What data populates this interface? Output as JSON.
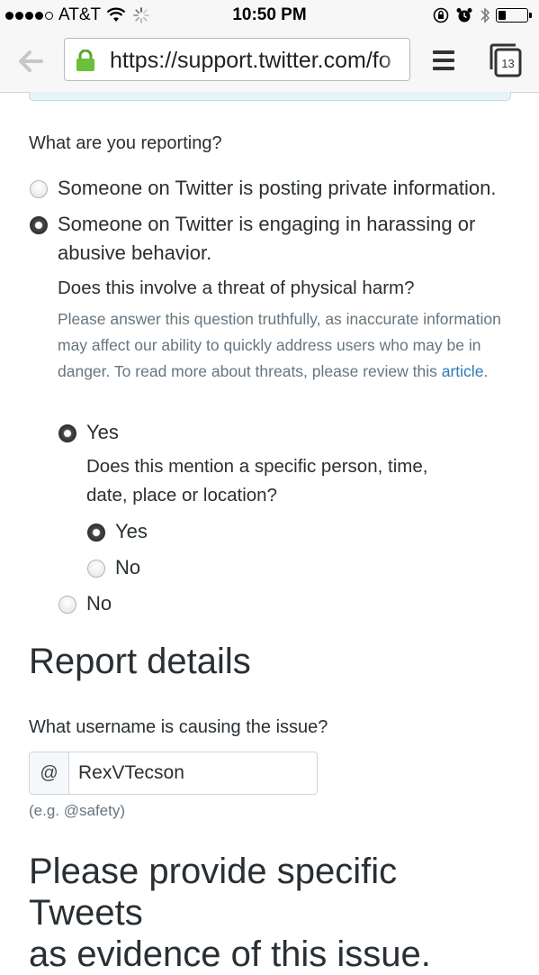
{
  "status_bar": {
    "carrier": "AT&T",
    "time": "10:50 PM",
    "battery_level": 0.25
  },
  "browser": {
    "url": "https://support.twitter.com/fo",
    "tab_count": "13",
    "icons": [
      "back-arrow-icon",
      "lock-icon",
      "menu-icon",
      "tabs-icon"
    ]
  },
  "form": {
    "question": "What are you reporting?",
    "options": [
      {
        "label": "Someone on Twitter is posting private information.",
        "selected": false
      },
      {
        "label_line1": "Someone on Twitter is engaging in harassing or",
        "label_line2": "abusive behavior.",
        "selected": true
      }
    ],
    "threat": {
      "question": "Does this involve a threat of physical harm?",
      "help_text": "Please answer this question truthfully, as inaccurate information may affect our ability to quickly address users who may be in danger. To read more about threats, please review this",
      "help_link": "article",
      "help_end": ".",
      "yes_label": "Yes",
      "no_label": "No",
      "selected": "Yes",
      "specific": {
        "question_line1": "Does this mention a specific person, time,",
        "question_line2": "date, place or location?",
        "yes_label": "Yes",
        "no_label": "No",
        "selected": "Yes"
      }
    }
  },
  "report_details": {
    "heading": "Report details",
    "username_question": "What username is causing the issue?",
    "at_prefix": "@",
    "username_value": "RexVTecson",
    "example": "(e.g. @safety)"
  },
  "evidence_heading": {
    "line1": "Please provide specific Tweets",
    "line2": "as evidence of this issue."
  }
}
